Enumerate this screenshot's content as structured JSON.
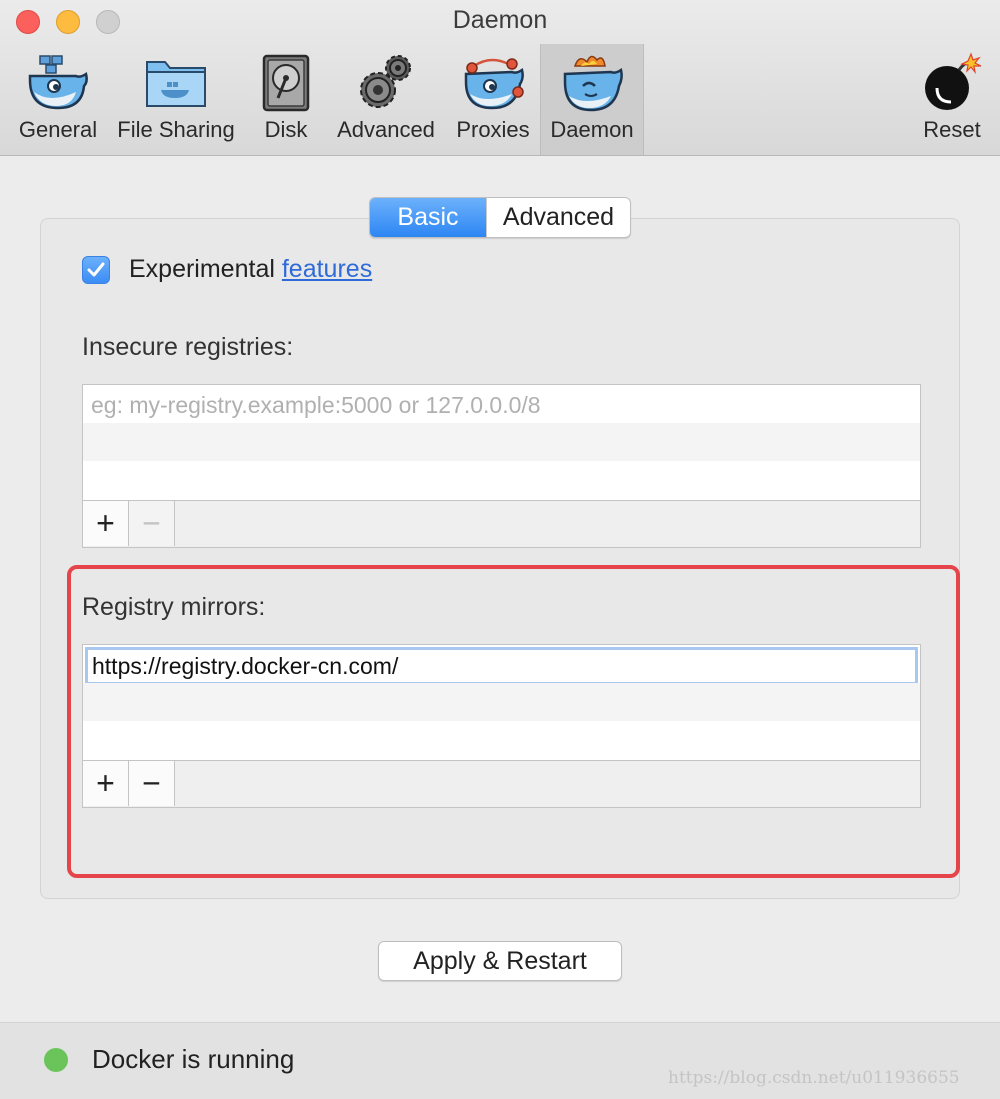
{
  "window": {
    "title": "Daemon"
  },
  "toolbar": {
    "items": [
      {
        "label": "General",
        "icon": "whale-icon"
      },
      {
        "label": "File Sharing",
        "icon": "folder-whale-icon"
      },
      {
        "label": "Disk",
        "icon": "disk-icon"
      },
      {
        "label": "Advanced",
        "icon": "gears-icon"
      },
      {
        "label": "Proxies",
        "icon": "whale-proxies-icon"
      },
      {
        "label": "Daemon",
        "icon": "whale-daemon-icon"
      },
      {
        "label": "Reset",
        "icon": "bomb-icon"
      }
    ],
    "active": "Daemon"
  },
  "tabs": {
    "basic": "Basic",
    "advanced": "Advanced",
    "selected": "Basic"
  },
  "experimental": {
    "checked": true,
    "label": "Experimental",
    "link": "features"
  },
  "insecure": {
    "label": "Insecure registries:",
    "placeholder": "eg: my-registry.example:5000 or 127.0.0.0/8",
    "add": "+",
    "remove": "−"
  },
  "mirrors": {
    "label": "Registry mirrors:",
    "value": "https://registry.docker-cn.com/",
    "add": "+",
    "remove": "−"
  },
  "apply_button": "Apply & Restart",
  "status": {
    "text": "Docker is running",
    "color": "#6ac45a"
  },
  "watermark": "https://blog.csdn.net/u011936655",
  "colors": {
    "accent": "#2d86f3",
    "highlight_border": "#e5454a",
    "link": "#2f6bd8"
  }
}
